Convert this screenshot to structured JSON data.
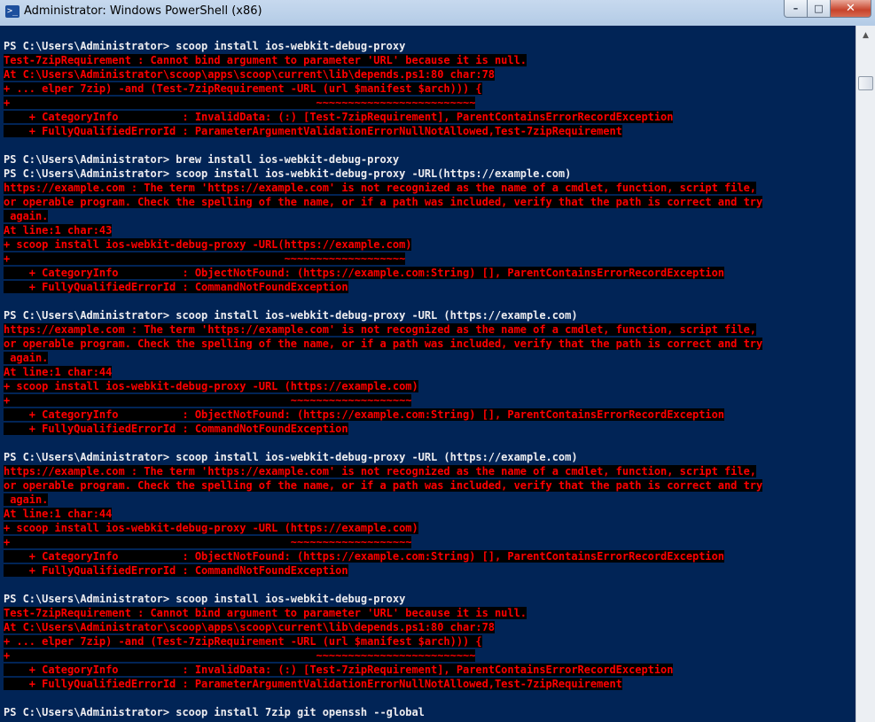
{
  "window": {
    "title": "Administrator: Windows PowerShell (x86)",
    "icon": "powershell-icon",
    "buttons": {
      "minimize": "–",
      "maximize": "□",
      "close": "✕"
    }
  },
  "console": {
    "background": "#012456",
    "command_color": "#eeedf0",
    "error_color": "#ff0000",
    "lines": [
      {
        "t": "cmd",
        "text": "PS C:\\Users\\Administrator> scoop install ios-webkit-debug-proxy"
      },
      {
        "t": "err",
        "text": "Test-7zipRequirement : Cannot bind argument to parameter 'URL' because it is null."
      },
      {
        "t": "err",
        "text": "At C:\\Users\\Administrator\\scoop\\apps\\scoop\\current\\lib\\depends.ps1:80 char:78"
      },
      {
        "t": "err",
        "text": "+ ... elper 7zip) -and (Test-7zipRequirement -URL (url $manifest $arch))) {"
      },
      {
        "t": "err",
        "text": "+                                                ~~~~~~~~~~~~~~~~~~~~~~~~~"
      },
      {
        "t": "err",
        "text": "    + CategoryInfo          : InvalidData: (:) [Test-7zipRequirement], ParentContainsErrorRecordException"
      },
      {
        "t": "err",
        "text": "    + FullyQualifiedErrorId : ParameterArgumentValidationErrorNullNotAllowed,Test-7zipRequirement"
      },
      {
        "t": "blank",
        "text": ""
      },
      {
        "t": "cmd",
        "text": "PS C:\\Users\\Administrator> brew install ios-webkit-debug-proxy"
      },
      {
        "t": "cmd",
        "text": "PS C:\\Users\\Administrator> scoop install ios-webkit-debug-proxy -URL(https://example.com)"
      },
      {
        "t": "err",
        "text": "https://example.com : The term 'https://example.com' is not recognized as the name of a cmdlet, function, script file,"
      },
      {
        "t": "err",
        "text": "or operable program. Check the spelling of the name, or if a path was included, verify that the path is correct and try"
      },
      {
        "t": "err",
        "text": " again."
      },
      {
        "t": "err",
        "text": "At line:1 char:43"
      },
      {
        "t": "err",
        "text": "+ scoop install ios-webkit-debug-proxy -URL(https://example.com)"
      },
      {
        "t": "err",
        "text": "+                                           ~~~~~~~~~~~~~~~~~~~"
      },
      {
        "t": "err",
        "text": "    + CategoryInfo          : ObjectNotFound: (https://example.com:String) [], ParentContainsErrorRecordException"
      },
      {
        "t": "err",
        "text": "    + FullyQualifiedErrorId : CommandNotFoundException"
      },
      {
        "t": "blank",
        "text": ""
      },
      {
        "t": "cmd",
        "text": "PS C:\\Users\\Administrator> scoop install ios-webkit-debug-proxy -URL (https://example.com)"
      },
      {
        "t": "err",
        "text": "https://example.com : The term 'https://example.com' is not recognized as the name of a cmdlet, function, script file,"
      },
      {
        "t": "err",
        "text": "or operable program. Check the spelling of the name, or if a path was included, verify that the path is correct and try"
      },
      {
        "t": "err",
        "text": " again."
      },
      {
        "t": "err",
        "text": "At line:1 char:44"
      },
      {
        "t": "err",
        "text": "+ scoop install ios-webkit-debug-proxy -URL (https://example.com)"
      },
      {
        "t": "err",
        "text": "+                                            ~~~~~~~~~~~~~~~~~~~"
      },
      {
        "t": "err",
        "text": "    + CategoryInfo          : ObjectNotFound: (https://example.com:String) [], ParentContainsErrorRecordException"
      },
      {
        "t": "err",
        "text": "    + FullyQualifiedErrorId : CommandNotFoundException"
      },
      {
        "t": "blank",
        "text": ""
      },
      {
        "t": "cmd",
        "text": "PS C:\\Users\\Administrator> scoop install ios-webkit-debug-proxy -URL (https://example.com)"
      },
      {
        "t": "err",
        "text": "https://example.com : The term 'https://example.com' is not recognized as the name of a cmdlet, function, script file,"
      },
      {
        "t": "err",
        "text": "or operable program. Check the spelling of the name, or if a path was included, verify that the path is correct and try"
      },
      {
        "t": "err",
        "text": " again."
      },
      {
        "t": "err",
        "text": "At line:1 char:44"
      },
      {
        "t": "err",
        "text": "+ scoop install ios-webkit-debug-proxy -URL (https://example.com)"
      },
      {
        "t": "err",
        "text": "+                                            ~~~~~~~~~~~~~~~~~~~"
      },
      {
        "t": "err",
        "text": "    + CategoryInfo          : ObjectNotFound: (https://example.com:String) [], ParentContainsErrorRecordException"
      },
      {
        "t": "err",
        "text": "    + FullyQualifiedErrorId : CommandNotFoundException"
      },
      {
        "t": "blank",
        "text": ""
      },
      {
        "t": "cmd",
        "text": "PS C:\\Users\\Administrator> scoop install ios-webkit-debug-proxy"
      },
      {
        "t": "err",
        "text": "Test-7zipRequirement : Cannot bind argument to parameter 'URL' because it is null."
      },
      {
        "t": "err",
        "text": "At C:\\Users\\Administrator\\scoop\\apps\\scoop\\current\\lib\\depends.ps1:80 char:78"
      },
      {
        "t": "err",
        "text": "+ ... elper 7zip) -and (Test-7zipRequirement -URL (url $manifest $arch))) {"
      },
      {
        "t": "err",
        "text": "+                                                ~~~~~~~~~~~~~~~~~~~~~~~~~"
      },
      {
        "t": "err",
        "text": "    + CategoryInfo          : InvalidData: (:) [Test-7zipRequirement], ParentContainsErrorRecordException"
      },
      {
        "t": "err",
        "text": "    + FullyQualifiedErrorId : ParameterArgumentValidationErrorNullNotAllowed,Test-7zipRequirement"
      },
      {
        "t": "blank",
        "text": ""
      },
      {
        "t": "cmd",
        "text": "PS C:\\Users\\Administrator> scoop install 7zip git openssh --global"
      }
    ]
  }
}
